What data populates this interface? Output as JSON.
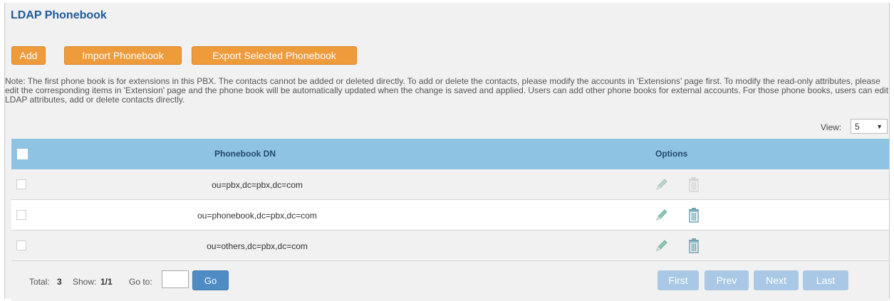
{
  "page": {
    "title": "LDAP Phonebook",
    "accent": "#ee9b3c",
    "header_bg": "#8fc3e3"
  },
  "toolbar": {
    "add_label": "Add",
    "import_label": "Import Phonebook",
    "export_label": "Export Selected Phonebook"
  },
  "note": "Note: The first phone book is for extensions in this PBX. The contacts cannot be added or deleted directly. To add or delete the contacts, please modify the accounts in 'Extensions' page first. To modify the read-only attributes, please edit the corresponding items in 'Extension' page and the phone book will be automatically updated when the change is saved and applied. Users can add other phone books for external accounts. For those phone books, users can edit LDAP attributes, add or delete contacts directly.",
  "view": {
    "label": "View:",
    "value": "5"
  },
  "table": {
    "columns": [
      "Phonebook DN",
      "Options"
    ],
    "rows": [
      {
        "dn": "ou=pbx,dc=pbx,dc=com",
        "delete_enabled": false
      },
      {
        "dn": "ou=phonebook,dc=pbx,dc=com",
        "delete_enabled": true
      },
      {
        "dn": "ou=others,dc=pbx,dc=com",
        "delete_enabled": true
      }
    ]
  },
  "footer": {
    "total_label": "Total:",
    "total_value": "3",
    "show_label": "Show:",
    "show_value": "1/1",
    "goto_label": "Go to:",
    "goto_value": "",
    "go_label": "Go",
    "first_label": "First",
    "prev_label": "Prev",
    "next_label": "Next",
    "last_label": "Last"
  }
}
